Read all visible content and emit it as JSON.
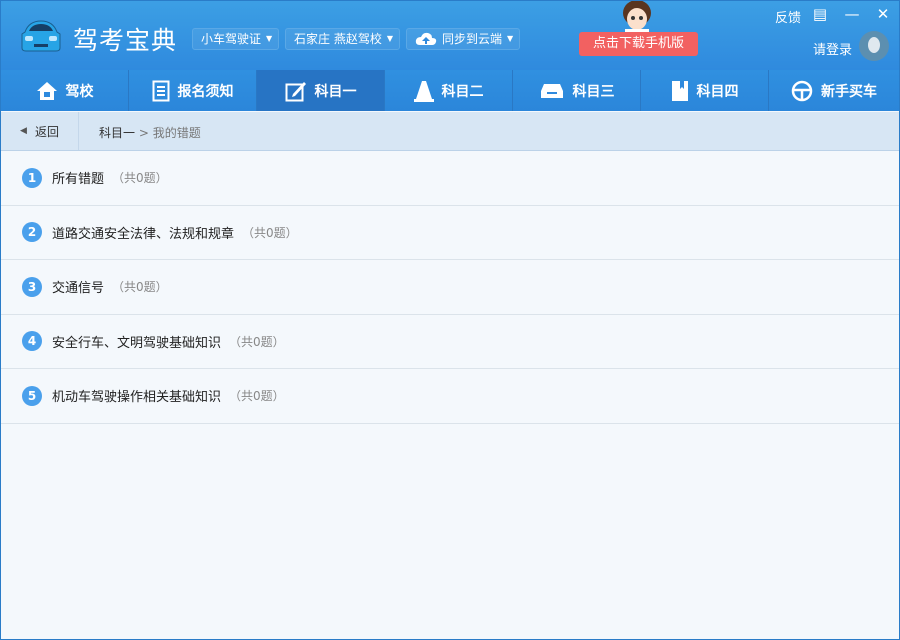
{
  "app": {
    "title": "驾考宝典"
  },
  "header": {
    "dropdowns": [
      {
        "label": "小车驾驶证"
      },
      {
        "label": "石家庄 燕赵驾校"
      },
      {
        "label": "同步到云端"
      }
    ],
    "download_label": "点击下载手机版",
    "feedback_label": "反馈",
    "login_label": "请登录"
  },
  "nav": {
    "tabs": [
      {
        "label": "驾校",
        "icon": "home-icon"
      },
      {
        "label": "报名须知",
        "icon": "document-icon"
      },
      {
        "label": "科目一",
        "icon": "edit-icon",
        "active": true
      },
      {
        "label": "科目二",
        "icon": "cone-icon"
      },
      {
        "label": "科目三",
        "icon": "car-icon"
      },
      {
        "label": "科目四",
        "icon": "book-icon"
      },
      {
        "label": "新手买车",
        "icon": "steering-wheel-icon"
      }
    ]
  },
  "breadcrumb": {
    "back_label": "返回",
    "parent": "科目一",
    "separator": ">",
    "current": "我的错题"
  },
  "list": {
    "items": [
      {
        "num": "1",
        "label": "所有错题",
        "count": "（共0题）"
      },
      {
        "num": "2",
        "label": "道路交通安全法律、法规和规章",
        "count": "（共0题）"
      },
      {
        "num": "3",
        "label": "交通信号",
        "count": "（共0题）"
      },
      {
        "num": "4",
        "label": "安全行车、文明驾驶基础知识",
        "count": "（共0题）"
      },
      {
        "num": "5",
        "label": "机动车驾驶操作相关基础知识",
        "count": "（共0题）"
      }
    ]
  }
}
